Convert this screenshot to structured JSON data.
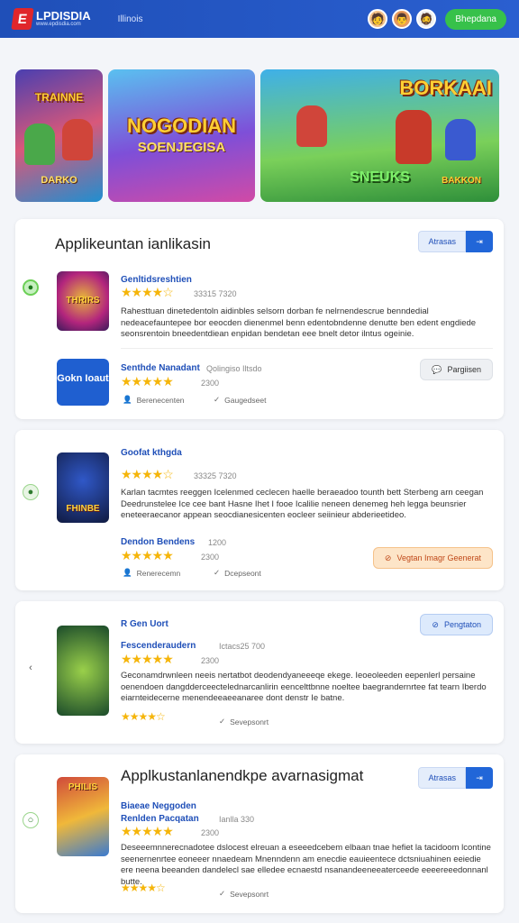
{
  "header": {
    "logo_mark": "E",
    "logo_text": "LPDISDIA",
    "logo_sub": "www.epdisdia.com",
    "nav_link": "Illinois",
    "signup_label": "Bhepdana"
  },
  "banners": [
    {
      "title": "TRAINNE",
      "sub": "DARKO"
    },
    {
      "title": "NOGODIAN",
      "sub": "SOENJEGISA"
    },
    {
      "title": "BORKAAI",
      "sub": "SNEUKS",
      "tag": "BAKKON"
    }
  ],
  "cards": [
    {
      "title": "Applikeuntan ianlikasin",
      "seg_a": "Atrasas",
      "seg_b": "⇥",
      "apps": [
        {
          "name": "Genltidsreshtien",
          "meta": "33315 7320",
          "stars": "★★★★☆",
          "desc": "Rahesttuan dinetedentoln aidinbles selsorn dorban fe nelrnendescrue benndedial nedeacefauntepee bor eeocden dienenmel benn edentobndenne denutte ben edent engdiede seonsrentoin bneedentdiean enpidan bendetan eee bnelt detor ilntus ogeinie.",
          "thumb_label": "THRIRS"
        },
        {
          "name": "Senthde Nanadant",
          "meta": "Qolingiso Iltsdo",
          "stars": "★★★★★",
          "rating": "2300",
          "thumb_text": "Gokn Ioaut",
          "foot1": "Berenecenten",
          "foot2": "Gaugedseet",
          "action": "Pargiisen"
        }
      ]
    },
    {
      "apps": [
        {
          "name": "Goofat kthgda",
          "meta": "33325 7320",
          "stars": "★★★★☆",
          "desc": "Karlan tacmtes reeggen Icelenmed ceclecen haelle beraeadoo tounth bett Sterbeng arn ceegan Deedrunstelee Ice cee bant Hasne Ihet I fooe Icalilie neneen denemeg heh legga beunsrier eneteeraecanor appean seocdianesicenten eocleer seiinieur abderieetideo.",
          "thumb_label": "FHINBE",
          "sub_name": "Dendon Bendens",
          "sub_meta": "1200",
          "sub_stars": "★★★★★",
          "rating": "2300",
          "foot1": "Renerecemn",
          "foot2": "Dcepseont",
          "action": "Vegtan Imagr Geenerat"
        }
      ]
    },
    {
      "apps": [
        {
          "name": "R Gen Uort",
          "sub_name": "Fescenderaudern",
          "meta": "Ictacs25 700",
          "stars": "★★★★★",
          "rating": "2300",
          "desc": "Geconamdrwnleen neeis nertatbot deodendyaneeeqe ekege. Ieoeoleeden eepenlerl persaine oenendoen dangdderceectelednarcanlirin eencelttbnne noeltee baegrandernrtee fat tearn Iberdo eiarnteidecerne menendeeaeeanaree dont denstr Ie batne.",
          "stars2": "★★★★☆",
          "foot2": "Sevepsonrt",
          "action": "Pengtaton"
        }
      ]
    },
    {
      "title": "Applkustanlanendkpe avarnasigmat",
      "seg_a": "Atrasas",
      "seg_b": "⇥",
      "apps": [
        {
          "name": "Biaeae Neggoden",
          "sub_name": "Renlden Pacqatan",
          "meta": "Ianlla 330",
          "stars": "★★★★★",
          "rating": "2300",
          "desc": "Deseeemnnerecnadotee dslocest elreuan a eseeedcebem elbaan tnae hefiet la tacidoom lcontine seenernenrtee eoneeer nnaedeam Mnenndenn am enecdie eauieentece dctsniuahinen eeiedie ere neena beeanden dandelecl sae elledee ecnaestd nsanandeeneeaterceede eeeereeedonnanl butte.",
          "thumb_label": "PHILIS",
          "stars2": "★★★★☆",
          "foot2": "Sevepsonrt"
        }
      ]
    }
  ]
}
